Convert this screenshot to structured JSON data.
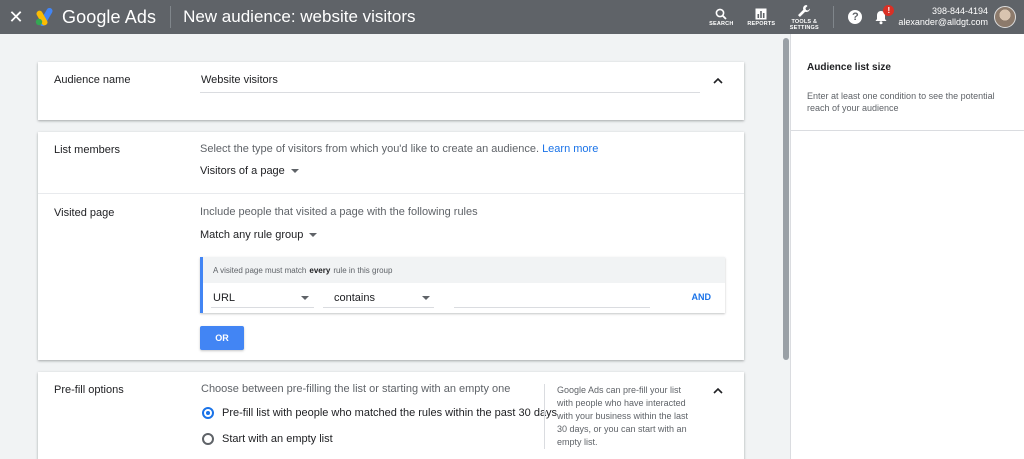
{
  "topbar": {
    "close_glyph": "✕",
    "brand": "Google Ads",
    "page_title": "New audience: website visitors",
    "tools": [
      {
        "label": "SEARCH",
        "icon": "search-icon"
      },
      {
        "label": "REPORTS",
        "icon": "reports-icon"
      },
      {
        "label": "TOOLS & SETTINGS",
        "icon": "wrench-icon"
      }
    ],
    "help_glyph": "?",
    "notification_badge": "!",
    "account_id": "398-844-4194",
    "account_email": "alexander@alldgt.com"
  },
  "audience_name": {
    "label": "Audience name",
    "value": "Website visitors"
  },
  "list_members": {
    "label": "List members",
    "helper": "Select the type of visitors from which you'd like to create an audience.",
    "learn_more": "Learn more",
    "selected": "Visitors of a page"
  },
  "visited_page": {
    "label": "Visited page",
    "helper": "Include people that visited a page with the following rules",
    "group_match": "Match any rule group",
    "rule_group": {
      "header_pre": "A visited page must match",
      "header_bold": "every",
      "header_post": "rule in this group",
      "field": "URL",
      "operator": "contains",
      "value": "",
      "and_label": "AND"
    },
    "or_label": "OR"
  },
  "prefill": {
    "label": "Pre-fill options",
    "helper": "Choose between pre-filling the list or starting with an empty one",
    "options": [
      {
        "label": "Pre-fill list with people who matched the rules within the past 30 days",
        "selected": true
      },
      {
        "label": "Start with an empty list",
        "selected": false
      }
    ],
    "note": "Google Ads can pre-fill your list with people who have interacted with your business within the last 30 days, or you can start with an empty list."
  },
  "side_panel": {
    "title": "Audience list size",
    "description": "Enter at least one condition to see the potential reach of your audience"
  },
  "colors": {
    "topbar": "#5f6368",
    "accent": "#1a73e8",
    "button": "#4285f4",
    "alert": "#d93025"
  }
}
